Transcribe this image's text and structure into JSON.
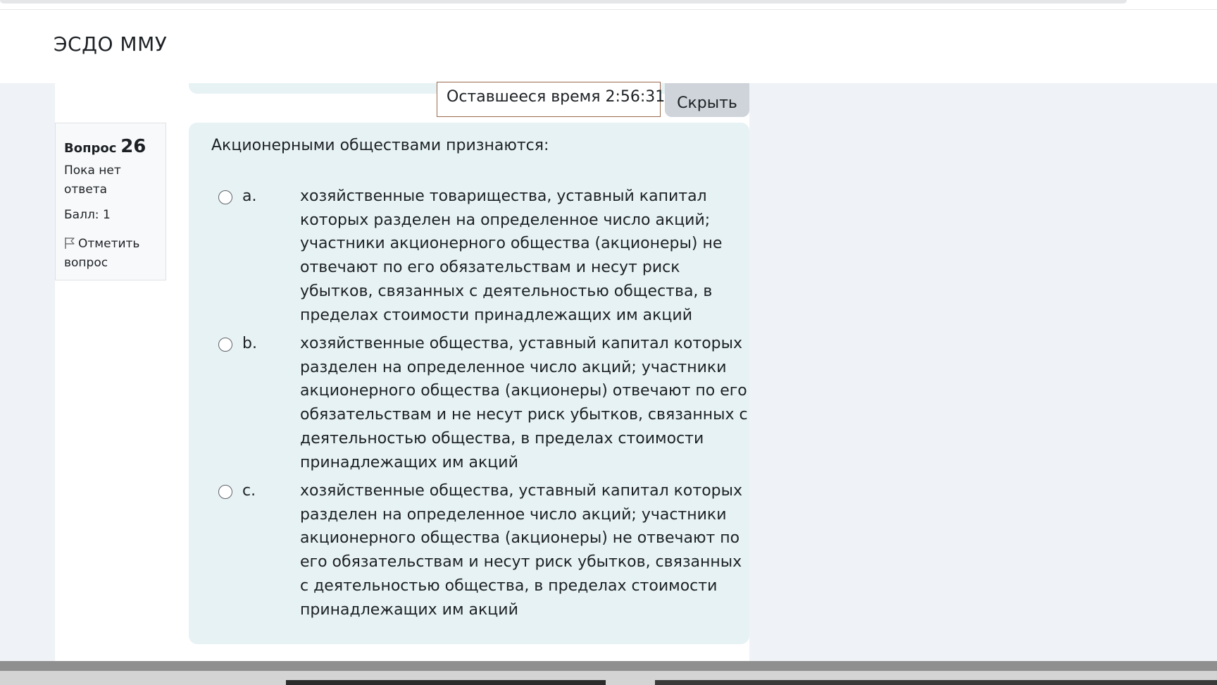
{
  "site": {
    "name": "ЭСДО ММУ"
  },
  "timer": {
    "label": "Оставшееся время 2:56:31",
    "hide_label": "Скрыть"
  },
  "question_info": {
    "label": "Вопрос",
    "number": "26",
    "state": "Пока нет ответа",
    "grade": "Балл: 1",
    "flag_label": "Отметить вопрос",
    "flag_icon": "flag-icon"
  },
  "question": {
    "text": "Акционерными обществами признаются:",
    "answers": [
      {
        "letter": "a.",
        "text": "хозяйственные товарищества, уставный капитал которых разделен на определенное число акций; участники акционерного общества (акционеры) не отвечают по его обязательствам и несут риск убытков, связанных с деятельностью общества, в пределах стоимости принадлежащих им акций",
        "selected": false
      },
      {
        "letter": "b.",
        "text": "хозяйственные общества, уставный капитал которых разделен на определенное число акций; участники акционерного общества (акционеры) отвечают по его обязательствам и не несут риск убытков, связанных с деятельностью общества, в пределах стоимости принадлежащих им акций",
        "selected": false
      },
      {
        "letter": "c.",
        "text": "хозяйственные общества, уставный капитал которых разделен на определенное число акций; участники акционерного общества (акционеры) не отвечают по его обязательствам и несут риск убытков, связанных с деятельностью общества, в пределах стоимости принадлежащих им акций",
        "selected": false
      }
    ]
  },
  "colors": {
    "card_bg": "#e7f2f4",
    "page_bg": "#eff2f6",
    "button_bg": "#ced4da",
    "timer_border": "#9a6a4e"
  }
}
